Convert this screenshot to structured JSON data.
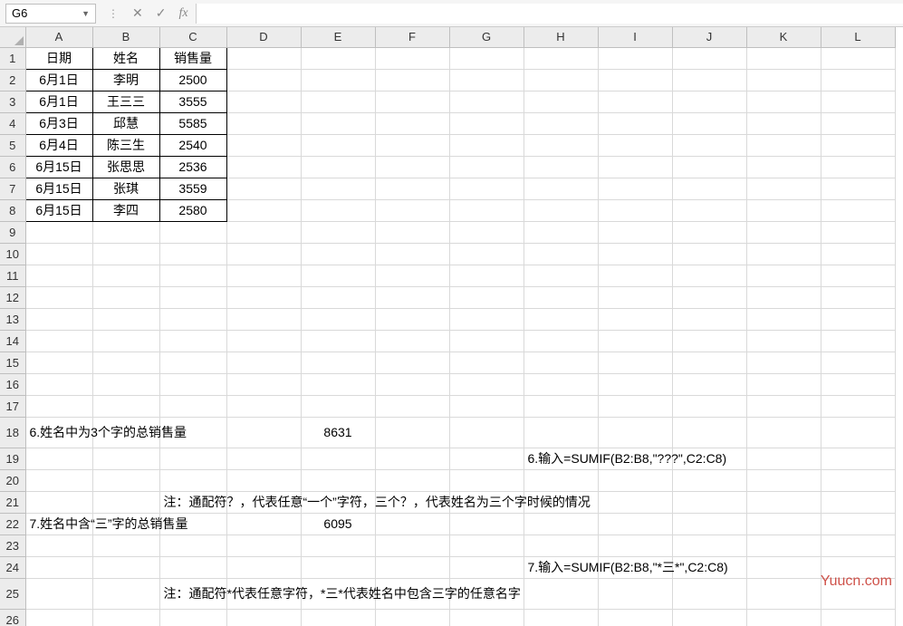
{
  "formula_bar": {
    "name_box": "G6",
    "formula": ""
  },
  "columns": [
    "A",
    "B",
    "C",
    "D",
    "E",
    "F",
    "G",
    "H",
    "I",
    "J",
    "K",
    "L"
  ],
  "rows": [
    "1",
    "2",
    "3",
    "4",
    "5",
    "6",
    "7",
    "8",
    "9",
    "10",
    "11",
    "12",
    "13",
    "14",
    "15",
    "16",
    "17",
    "18",
    "19",
    "20",
    "21",
    "22",
    "23",
    "24",
    "25",
    "26"
  ],
  "header": {
    "date": "日期",
    "name": "姓名",
    "sales": "销售量"
  },
  "data_rows": [
    {
      "date": "6月1日",
      "name": "李明",
      "sales": "2500"
    },
    {
      "date": "6月1日",
      "name": "王三三",
      "sales": "3555"
    },
    {
      "date": "6月3日",
      "name": "邱慧",
      "sales": "5585"
    },
    {
      "date": "6月4日",
      "name": "陈三生",
      "sales": "2540"
    },
    {
      "date": "6月15日",
      "name": "张思思",
      "sales": "2536"
    },
    {
      "date": "6月15日",
      "name": "张琪",
      "sales": "3559"
    },
    {
      "date": "6月15日",
      "name": "李四",
      "sales": "2580"
    }
  ],
  "notes": {
    "q6_label": "6.姓名中为3个字的总销售量",
    "q6_value": "8631",
    "q6_formula": "6.输入=SUMIF(B2:B8,\"???\",C2:C8)",
    "q6_note": "注：通配符？，代表任意“一个”字符，三个？，代表姓名为三个字时候的情况",
    "q7_label": "7.姓名中含“三”字的总销售量",
    "q7_value": "6095",
    "q7_formula": "7.输入=SUMIF(B2:B8,\"*三*\",C2:C8)",
    "q7_note": "注：通配符*代表任意字符，*三*代表姓名中包含三字的任意名字"
  },
  "watermark": "Yuucn.com"
}
